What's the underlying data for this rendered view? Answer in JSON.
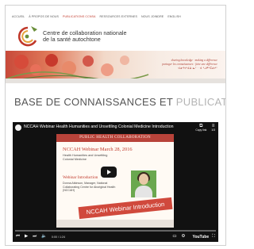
{
  "nav": {
    "items": [
      {
        "label": "ACCUEIL"
      },
      {
        "label": "À PROPOS DE NOUS"
      },
      {
        "label": "PUBLICATIONS CCNSA",
        "active": true
      },
      {
        "label": "RESSOURCES EXTERNES"
      },
      {
        "label": "NOUS JOINDRE"
      },
      {
        "label": "ENGLISH"
      }
    ]
  },
  "header": {
    "org_line1": "Centre de collaboration nationale",
    "org_line2": "de la santé autochtone"
  },
  "hero": {
    "tagline_line1": "sharing knowledge · making a difference",
    "tagline_line2": "partager les connaissances · faire une différence",
    "tagline_syllabics": "ᐊᓂᔮᓯᐊᐃᐧᓇᐤ · ᐊᐧᐦᒍᑭᐦᑖᑯᓯᐤ"
  },
  "page": {
    "heading_main": "BASE DE CONNAISSANCES ET",
    "heading_light": "PUBLICATIONS"
  },
  "video": {
    "title": "NCCAH Webinar Health Humanities and Unsettling Colonial Medicine Introduction",
    "copy_link_label": "Copy link",
    "playlist_count": "1/3",
    "slide": {
      "header": "PUBLIC HEALTH COLLABORATION",
      "title": "NCCAH Webinar March 28, 2016",
      "subtitle": "Health Humanities and Unsettling Colonial Medicine",
      "section_title": "Webinar Introduction",
      "speaker": "Donna Atkinson, Manager, National Collaborating Centre for Aboriginal Health (NCCAH)",
      "banner": "NCCAH Webinar Introduction"
    },
    "time": "0:00 / 1:24",
    "youtube_label": "YouTube"
  },
  "colors": {
    "accent": "#c0392b",
    "banner": "#d0493c",
    "video_bg": "#111111"
  }
}
